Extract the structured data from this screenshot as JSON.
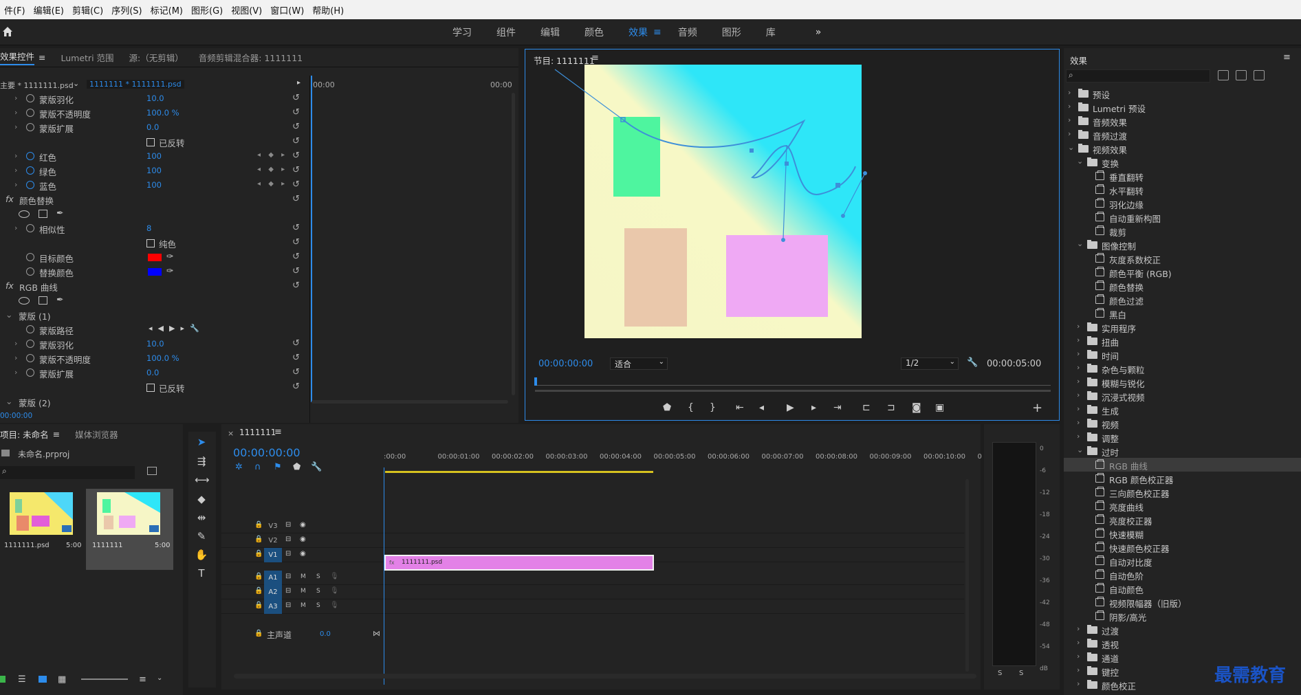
{
  "menu": [
    "件(F)",
    "编辑(E)",
    "剪辑(C)",
    "序列(S)",
    "标记(M)",
    "图形(G)",
    "视图(V)",
    "窗口(W)",
    "帮助(H)"
  ],
  "workspaces": [
    {
      "label": "学习"
    },
    {
      "label": "组件"
    },
    {
      "label": "编辑"
    },
    {
      "label": "颜色"
    },
    {
      "label": "效果",
      "active": true
    },
    {
      "label": "音频"
    },
    {
      "label": "图形"
    },
    {
      "label": "库"
    }
  ],
  "effect_controls": {
    "tabs": [
      "效果控件",
      "Lumetri 范围",
      "源:（无剪辑）",
      "音频剪辑混合器: 1111111"
    ],
    "master": "主要 * 1111111.psd",
    "clip": "1111111 * 1111111.psd",
    "time_start": "00:00",
    "time_end": "00:00",
    "current_time": "00:00:00",
    "rows": [
      {
        "label": "蒙版羽化",
        "value": "10.0"
      },
      {
        "label": "蒙版不透明度",
        "value": "100.0 %"
      },
      {
        "label": "蒙版扩展",
        "value": "0.0"
      },
      {
        "label": "已反转",
        "check": true
      },
      {
        "label": "红色",
        "value": "100",
        "kf": true
      },
      {
        "label": "绿色",
        "value": "100",
        "kf": true
      },
      {
        "label": "蓝色",
        "value": "100",
        "kf": true
      },
      {
        "label": "颜色替换",
        "fx": true
      },
      {
        "label": "",
        "masks": true
      },
      {
        "label": "相似性",
        "value": "8"
      },
      {
        "label": "纯色",
        "check": true
      },
      {
        "label": "目标颜色",
        "color": "#ff0000"
      },
      {
        "label": "替换颜色",
        "color": "#0000ff"
      },
      {
        "label": "RGB 曲线",
        "fx": true
      },
      {
        "label": "",
        "masks": true
      },
      {
        "label": "蒙版 (1)",
        "group": true
      },
      {
        "label": "蒙版路径",
        "path": true
      },
      {
        "label": "蒙版羽化",
        "value": "10.0"
      },
      {
        "label": "蒙版不透明度",
        "value": "100.0 %"
      },
      {
        "label": "蒙版扩展",
        "value": "0.0"
      },
      {
        "label": "已反转",
        "check": true
      },
      {
        "label": "蒙版 (2)",
        "group": true
      }
    ]
  },
  "program": {
    "title": "节目: 1111111",
    "timecode": "00:00:00:00",
    "fit": "适合",
    "resolution": "1/2",
    "duration": "00:00:05:00"
  },
  "effects_panel": {
    "title": "效果",
    "search_placeholder": "",
    "items": [
      {
        "label": "预设",
        "level": 0,
        "type": "folder",
        "open": false
      },
      {
        "label": "Lumetri 预设",
        "level": 0,
        "type": "folder",
        "open": false
      },
      {
        "label": "音频效果",
        "level": 0,
        "type": "folder",
        "open": false
      },
      {
        "label": "音频过渡",
        "level": 0,
        "type": "folder",
        "open": false
      },
      {
        "label": "视频效果",
        "level": 0,
        "type": "folder",
        "open": true
      },
      {
        "label": "变换",
        "level": 1,
        "type": "folder",
        "open": true
      },
      {
        "label": "垂直翻转",
        "level": 2,
        "type": "fx"
      },
      {
        "label": "水平翻转",
        "level": 2,
        "type": "fx"
      },
      {
        "label": "羽化边缘",
        "level": 2,
        "type": "fx"
      },
      {
        "label": "自动重新构图",
        "level": 2,
        "type": "fx"
      },
      {
        "label": "裁剪",
        "level": 2,
        "type": "fx"
      },
      {
        "label": "图像控制",
        "level": 1,
        "type": "folder",
        "open": true
      },
      {
        "label": "灰度系数校正",
        "level": 2,
        "type": "fx"
      },
      {
        "label": "颜色平衡 (RGB)",
        "level": 2,
        "type": "fx"
      },
      {
        "label": "颜色替换",
        "level": 2,
        "type": "fx"
      },
      {
        "label": "颜色过滤",
        "level": 2,
        "type": "fx"
      },
      {
        "label": "黑白",
        "level": 2,
        "type": "fx"
      },
      {
        "label": "实用程序",
        "level": 1,
        "type": "folder",
        "open": false
      },
      {
        "label": "扭曲",
        "level": 1,
        "type": "folder",
        "open": false
      },
      {
        "label": "时间",
        "level": 1,
        "type": "folder",
        "open": false
      },
      {
        "label": "杂色与颗粒",
        "level": 1,
        "type": "folder",
        "open": false
      },
      {
        "label": "模糊与锐化",
        "level": 1,
        "type": "folder",
        "open": false
      },
      {
        "label": "沉浸式视频",
        "level": 1,
        "type": "folder",
        "open": false
      },
      {
        "label": "生成",
        "level": 1,
        "type": "folder",
        "open": false
      },
      {
        "label": "视频",
        "level": 1,
        "type": "folder",
        "open": false
      },
      {
        "label": "调整",
        "level": 1,
        "type": "folder",
        "open": false
      },
      {
        "label": "过时",
        "level": 1,
        "type": "folder",
        "open": true
      },
      {
        "label": "RGB 曲线",
        "level": 2,
        "type": "fx",
        "selected": true
      },
      {
        "label": "RGB 颜色校正器",
        "level": 2,
        "type": "fx"
      },
      {
        "label": "三向颜色校正器",
        "level": 2,
        "type": "fx"
      },
      {
        "label": "亮度曲线",
        "level": 2,
        "type": "fx"
      },
      {
        "label": "亮度校正器",
        "level": 2,
        "type": "fx"
      },
      {
        "label": "快速模糊",
        "level": 2,
        "type": "fx"
      },
      {
        "label": "快速颜色校正器",
        "level": 2,
        "type": "fx"
      },
      {
        "label": "自动对比度",
        "level": 2,
        "type": "fx"
      },
      {
        "label": "自动色阶",
        "level": 2,
        "type": "fx"
      },
      {
        "label": "自动颜色",
        "level": 2,
        "type": "fx"
      },
      {
        "label": "视频限幅器（旧版）",
        "level": 2,
        "type": "fx"
      },
      {
        "label": "阴影/高光",
        "level": 2,
        "type": "fx"
      },
      {
        "label": "过渡",
        "level": 1,
        "type": "folder",
        "open": false
      },
      {
        "label": "透视",
        "level": 1,
        "type": "folder",
        "open": false
      },
      {
        "label": "通道",
        "level": 1,
        "type": "folder",
        "open": false
      },
      {
        "label": "键控",
        "level": 1,
        "type": "folder",
        "open": false
      },
      {
        "label": "颜色校正",
        "level": 1,
        "type": "folder",
        "open": false
      }
    ]
  },
  "project": {
    "tabs": [
      "项目: 未命名",
      "媒体浏览器"
    ],
    "file": "未命名.prproj",
    "items": [
      {
        "name": "1111111.psd",
        "dur": "5:00"
      },
      {
        "name": "1111111",
        "dur": "5:00"
      }
    ]
  },
  "timeline": {
    "tab": "1111111",
    "timecode": "00:00:00:00",
    "ruler": [
      ":00:00",
      "00:00:01:00",
      "00:00:02:00",
      "00:00:03:00",
      "00:00:04:00",
      "00:00:05:00",
      "00:00:06:00",
      "00:00:07:00",
      "00:00:08:00",
      "00:00:09:00",
      "00:00:10:00",
      "0"
    ],
    "video_tracks": [
      "V3",
      "V2",
      "V1"
    ],
    "audio_tracks": [
      "A1",
      "A2",
      "A3"
    ],
    "clip": "1111111.psd",
    "master_label": "主声道",
    "master_value": "0.0"
  },
  "meter": {
    "ticks": [
      "0",
      "-6",
      "-12",
      "-18",
      "-24",
      "-30",
      "-36",
      "-42",
      "-48",
      "-54",
      "dB"
    ],
    "solo": [
      "S",
      "S"
    ]
  },
  "watermark": "最需教育"
}
